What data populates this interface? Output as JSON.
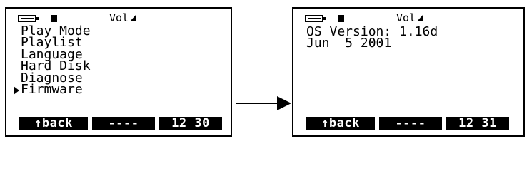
{
  "left_screen": {
    "status": {
      "volume_label": "Vol"
    },
    "menu_items": [
      "Play Mode",
      "Playlist",
      "Language",
      "Hard Disk",
      "Diagnose",
      "Firmware"
    ],
    "selected_index": 5,
    "softkeys": {
      "back": "↑back",
      "middle": "----",
      "time": "12 30"
    }
  },
  "right_screen": {
    "status": {
      "volume_label": "Vol"
    },
    "lines": [
      "OS Version: 1.16d",
      "Jun  5 2001"
    ],
    "softkeys": {
      "back": "↑back",
      "middle": "----",
      "time": "12 31"
    }
  }
}
